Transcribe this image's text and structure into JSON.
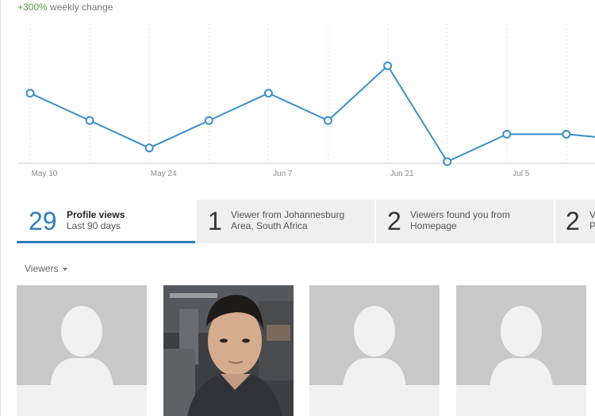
{
  "header": {
    "change_value": "+300%",
    "change_label": "weekly change"
  },
  "chart_data": {
    "type": "line",
    "x_tick_labels": [
      "May 10",
      "May 24",
      "Jun 7",
      "Jun 21",
      "Jul 5"
    ],
    "points": [
      {
        "index": 0,
        "value": 5
      },
      {
        "index": 1,
        "value": 3
      },
      {
        "index": 2,
        "value": 1
      },
      {
        "index": 3,
        "value": 3
      },
      {
        "index": 4,
        "value": 5
      },
      {
        "index": 5,
        "value": 3
      },
      {
        "index": 6,
        "value": 7
      },
      {
        "index": 7,
        "value": 0
      },
      {
        "index": 8,
        "value": 2
      },
      {
        "index": 9,
        "value": 2
      },
      {
        "index": 10,
        "value": 1.6
      }
    ],
    "ylim": [
      0,
      7
    ],
    "grid": "vertical-dashed",
    "line_color": "#3a8fc9"
  },
  "tiles": [
    {
      "number": "29",
      "line1": "Profile views",
      "line2": "Last 90 days"
    },
    {
      "number": "1",
      "line1": "Viewer from Johannesburg",
      "line2": "Area, South Africa"
    },
    {
      "number": "2",
      "line1": "Viewers found you from",
      "line2": "Homepage"
    },
    {
      "number": "2",
      "line1": "V",
      "line2": "P"
    }
  ],
  "viewers": {
    "label": "Viewers",
    "cards": [
      {
        "type": "placeholder-avatar"
      },
      {
        "type": "photo"
      },
      {
        "type": "placeholder-avatar"
      },
      {
        "type": "placeholder-avatar"
      }
    ]
  },
  "colors": {
    "accent": "#2f7db8",
    "positive": "#5a9e3e",
    "tile_bg": "#efefef",
    "avatar_bg": "#c8c8c8"
  }
}
